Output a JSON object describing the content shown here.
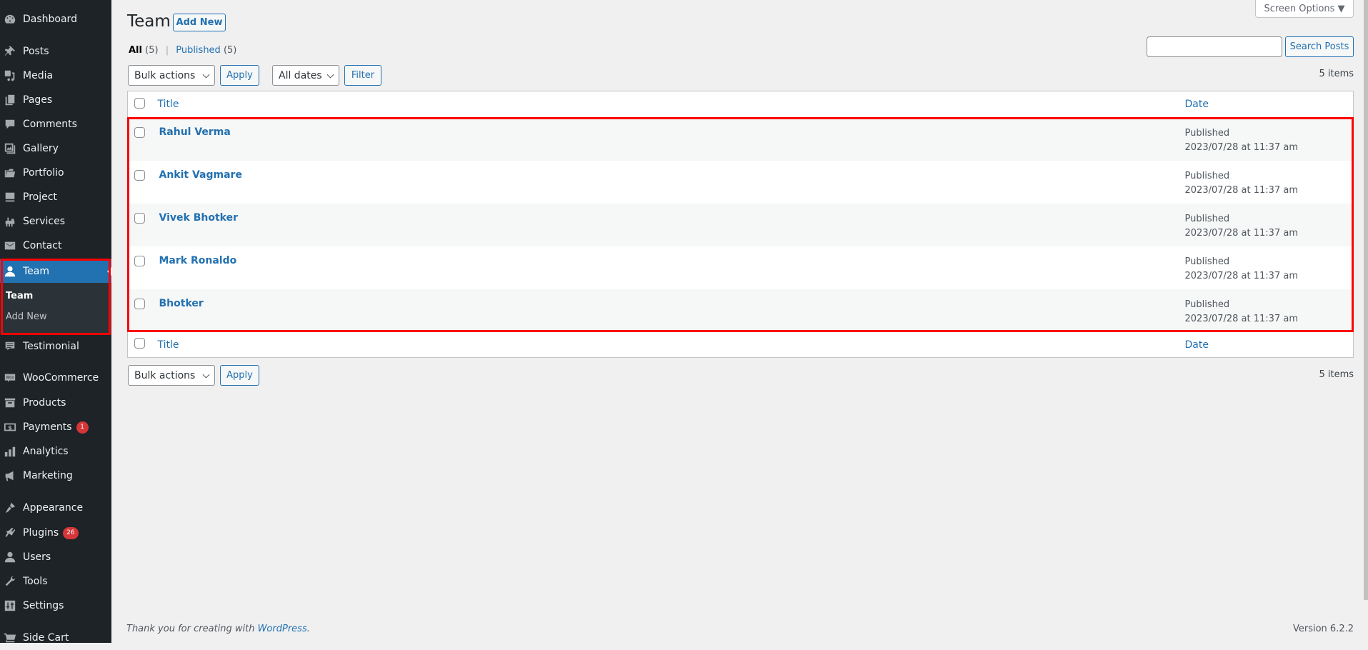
{
  "sidebar": {
    "items": [
      {
        "label": "Dashboard",
        "icon": "dashboard-icon"
      },
      {
        "label": "Posts",
        "icon": "pushpin-icon"
      },
      {
        "label": "Media",
        "icon": "media-icon"
      },
      {
        "label": "Pages",
        "icon": "pages-icon"
      },
      {
        "label": "Comments",
        "icon": "comment-icon"
      },
      {
        "label": "Gallery",
        "icon": "gallery-icon"
      },
      {
        "label": "Portfolio",
        "icon": "folder-icon"
      },
      {
        "label": "Project",
        "icon": "desktop-icon"
      },
      {
        "label": "Services",
        "icon": "services-icon"
      },
      {
        "label": "Contact",
        "icon": "envelope-icon"
      },
      {
        "label": "Team",
        "icon": "user-icon",
        "current": true
      },
      {
        "label": "Testimonial",
        "icon": "testimonial-icon"
      },
      {
        "label": "WooCommerce",
        "icon": "woocommerce-icon"
      },
      {
        "label": "Products",
        "icon": "archive-icon"
      },
      {
        "label": "Payments",
        "icon": "dollar-icon",
        "badge": "1"
      },
      {
        "label": "Analytics",
        "icon": "bar-chart-icon"
      },
      {
        "label": "Marketing",
        "icon": "megaphone-icon"
      },
      {
        "label": "Appearance",
        "icon": "paintbrush-icon"
      },
      {
        "label": "Plugins",
        "icon": "plugin-icon",
        "badge": "26"
      },
      {
        "label": "Users",
        "icon": "users-icon"
      },
      {
        "label": "Tools",
        "icon": "wrench-icon"
      },
      {
        "label": "Settings",
        "icon": "settings-icon"
      },
      {
        "label": "Side Cart",
        "icon": "cart-icon"
      }
    ],
    "submenu": [
      {
        "label": "Team",
        "current": true
      },
      {
        "label": "Add New"
      }
    ]
  },
  "header": {
    "title": "Team",
    "add_new_label": "Add New",
    "screen_options_label": "Screen Options ▼"
  },
  "filters": {
    "all_label": "All",
    "all_count": "(5)",
    "published_label": "Published",
    "published_count": "(5)",
    "separator": "|"
  },
  "search": {
    "value": "",
    "button_label": "Search Posts"
  },
  "tablenav_top": {
    "bulk_actions": "Bulk actions",
    "apply_label": "Apply",
    "dates": "All dates",
    "filter_label": "Filter",
    "items_count": "5 items"
  },
  "table": {
    "columns": {
      "title": "Title",
      "date": "Date"
    },
    "rows": [
      {
        "title": "Rahul Verma",
        "status": "Published",
        "date": "2023/07/28 at 11:37 am"
      },
      {
        "title": "Ankit Vagmare",
        "status": "Published",
        "date": "2023/07/28 at 11:37 am"
      },
      {
        "title": "Vivek Bhotker",
        "status": "Published",
        "date": "2023/07/28 at 11:37 am"
      },
      {
        "title": "Mark Ronaldo",
        "status": "Published",
        "date": "2023/07/28 at 11:37 am"
      },
      {
        "title": "Bhotker",
        "status": "Published",
        "date": "2023/07/28 at 11:37 am"
      }
    ]
  },
  "tablenav_bottom": {
    "bulk_actions": "Bulk actions",
    "apply_label": "Apply",
    "items_count": "5 items"
  },
  "footer": {
    "thanks_text": "Thank you for creating with ",
    "wordpress_link": "WordPress",
    "period": ".",
    "version": "Version 6.2.2"
  },
  "colors": {
    "accent": "#2271b1",
    "sidebar_bg": "#1d2327",
    "badge": "#d63638",
    "highlight": "#ff0000"
  }
}
